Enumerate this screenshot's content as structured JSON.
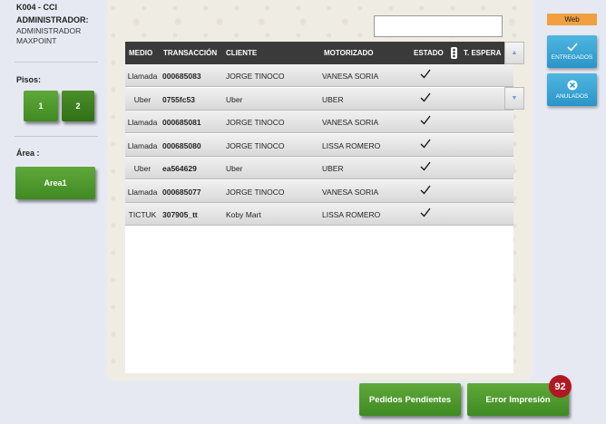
{
  "header": {
    "store": "K004 - CCI",
    "role": "ADMINISTRADOR:",
    "user_line1": "ADMINISTRADOR",
    "user_line2": "MAXPOINT"
  },
  "floors": {
    "label": "Pisos:",
    "items": [
      "1",
      "2"
    ]
  },
  "area": {
    "label": "Área :",
    "button": "Area1"
  },
  "search": {
    "value": "",
    "placeholder": ""
  },
  "table": {
    "columns": {
      "medio": "MEDIO",
      "transaccion": "TRANSACCIÓN",
      "cliente": "CLIENTE",
      "motorizado": "MOTORIZADO",
      "estado": "ESTADO",
      "espera": "T. ESPERA"
    },
    "rows": [
      {
        "medio": "Llamada",
        "transaccion": "000685083",
        "cliente": "JORGE TINOCO",
        "motorizado": "VANESA SORIA"
      },
      {
        "medio": "Uber",
        "transaccion": "0755fc53",
        "cliente": "Uber",
        "motorizado": "UBER"
      },
      {
        "medio": "Llamada",
        "transaccion": "000685081",
        "cliente": "JORGE TINOCO",
        "motorizado": "VANESA SORIA"
      },
      {
        "medio": "Llamada",
        "transaccion": "000685080",
        "cliente": "JORGE TINOCO",
        "motorizado": "LISSA ROMERO"
      },
      {
        "medio": "Uber",
        "transaccion": "ea564629",
        "cliente": "Uber",
        "motorizado": "UBER"
      },
      {
        "medio": "Llamada",
        "transaccion": "000685077",
        "cliente": "JORGE TINOCO",
        "motorizado": "VANESA SORIA"
      },
      {
        "medio": "TICTUK",
        "transaccion": "307905_tt",
        "cliente": "Koby Mart",
        "motorizado": "LISSA ROMERO"
      }
    ]
  },
  "right": {
    "web": "Web",
    "entregados": "ENTREGADOS",
    "anulados": "ANULADOS"
  },
  "bottom": {
    "pendientes": "Pedidos Pendientes",
    "error": "Error Impresión",
    "error_count": "92"
  },
  "colors": {
    "green": "#4a9a2c",
    "blue": "#2a95c8",
    "badge": "#b01822",
    "header": "#3a3a3a"
  }
}
